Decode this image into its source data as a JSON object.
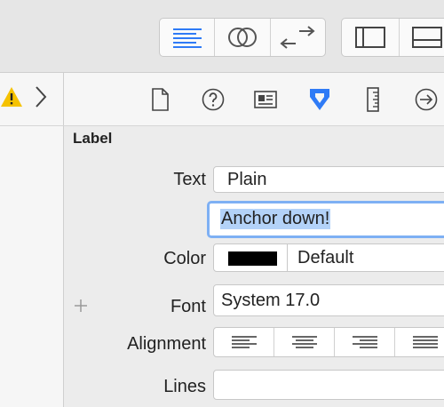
{
  "warning_icon": "warning-triangle-icon",
  "section_title": "Label",
  "rows": {
    "text_label": "Text",
    "text_type": "Plain",
    "text_value": "Anchor down!",
    "color_label": "Color",
    "color_value": "Default",
    "color_swatch": "#000000",
    "font_label": "Font",
    "font_value": "System 17.0",
    "alignment_label": "Alignment",
    "lines_label": "Lines"
  },
  "accent": "#2f7bf6",
  "selection": "#b3d2f8"
}
